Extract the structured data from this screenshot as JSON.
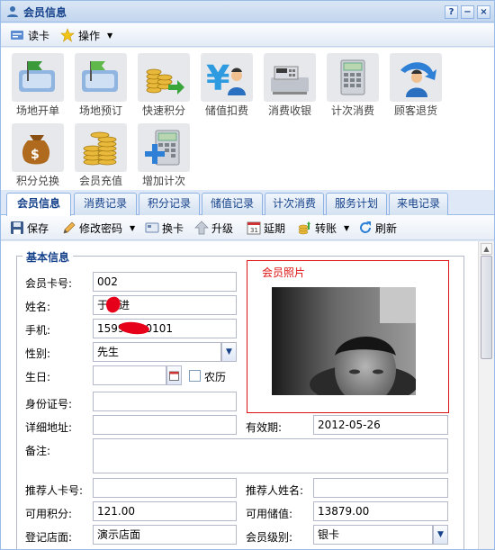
{
  "window": {
    "title": "会员信息",
    "btn_help": "?",
    "btn_min": "−",
    "btn_close": "×"
  },
  "menu": {
    "read_card": "读卡",
    "operation": "操作"
  },
  "tiles": [
    {
      "label": "场地开单",
      "icon": "venue-open-icon"
    },
    {
      "label": "场地预订",
      "icon": "venue-book-icon"
    },
    {
      "label": "快速积分",
      "icon": "quick-points-icon"
    },
    {
      "label": "储值扣费",
      "icon": "stored-value-deduct-icon"
    },
    {
      "label": "消费收银",
      "icon": "cash-register-icon"
    },
    {
      "label": "计次消费",
      "icon": "count-consume-icon"
    },
    {
      "label": "顾客退货",
      "icon": "customer-return-icon"
    },
    {
      "label": "积分兑换",
      "icon": "points-exchange-icon"
    },
    {
      "label": "会员充值",
      "icon": "member-recharge-icon"
    },
    {
      "label": "增加计次",
      "icon": "add-count-icon"
    }
  ],
  "tabs": [
    "会员信息",
    "消费记录",
    "积分记录",
    "储值记录",
    "计次消费",
    "服务计划",
    "来电记录"
  ],
  "toolbar": {
    "save": "保存",
    "change_password": "修改密码",
    "change_card": "换卡",
    "upgrade": "升级",
    "extend": "延期",
    "transfer": "转账",
    "refresh": "刷新"
  },
  "form": {
    "section_title": "基本信息",
    "photo_title": "会员照片",
    "card_no_label": "会员卡号:",
    "card_no": "002",
    "name_label": "姓名:",
    "name": "于雅进",
    "phone_label": "手机:",
    "phone": "15999990101",
    "gender_label": "性别:",
    "gender": "先生",
    "birthday_label": "生日:",
    "birthday": "",
    "lunar_label": "农历",
    "id_label": "身份证号:",
    "id": "",
    "address_label": "详细地址:",
    "address": "",
    "valid_label": "有效期:",
    "valid": "2012-05-26",
    "remark_label": "备注:",
    "remark": "",
    "ref_card_label": "推荐人卡号:",
    "ref_card": "",
    "ref_name_label": "推荐人姓名:",
    "ref_name": "",
    "points_label": "可用积分:",
    "points": "121.00",
    "stored_label": "可用储值:",
    "stored": "13879.00",
    "store_label": "登记店面:",
    "store": "演示店面",
    "level_label": "会员级别:",
    "level": "银卡"
  }
}
